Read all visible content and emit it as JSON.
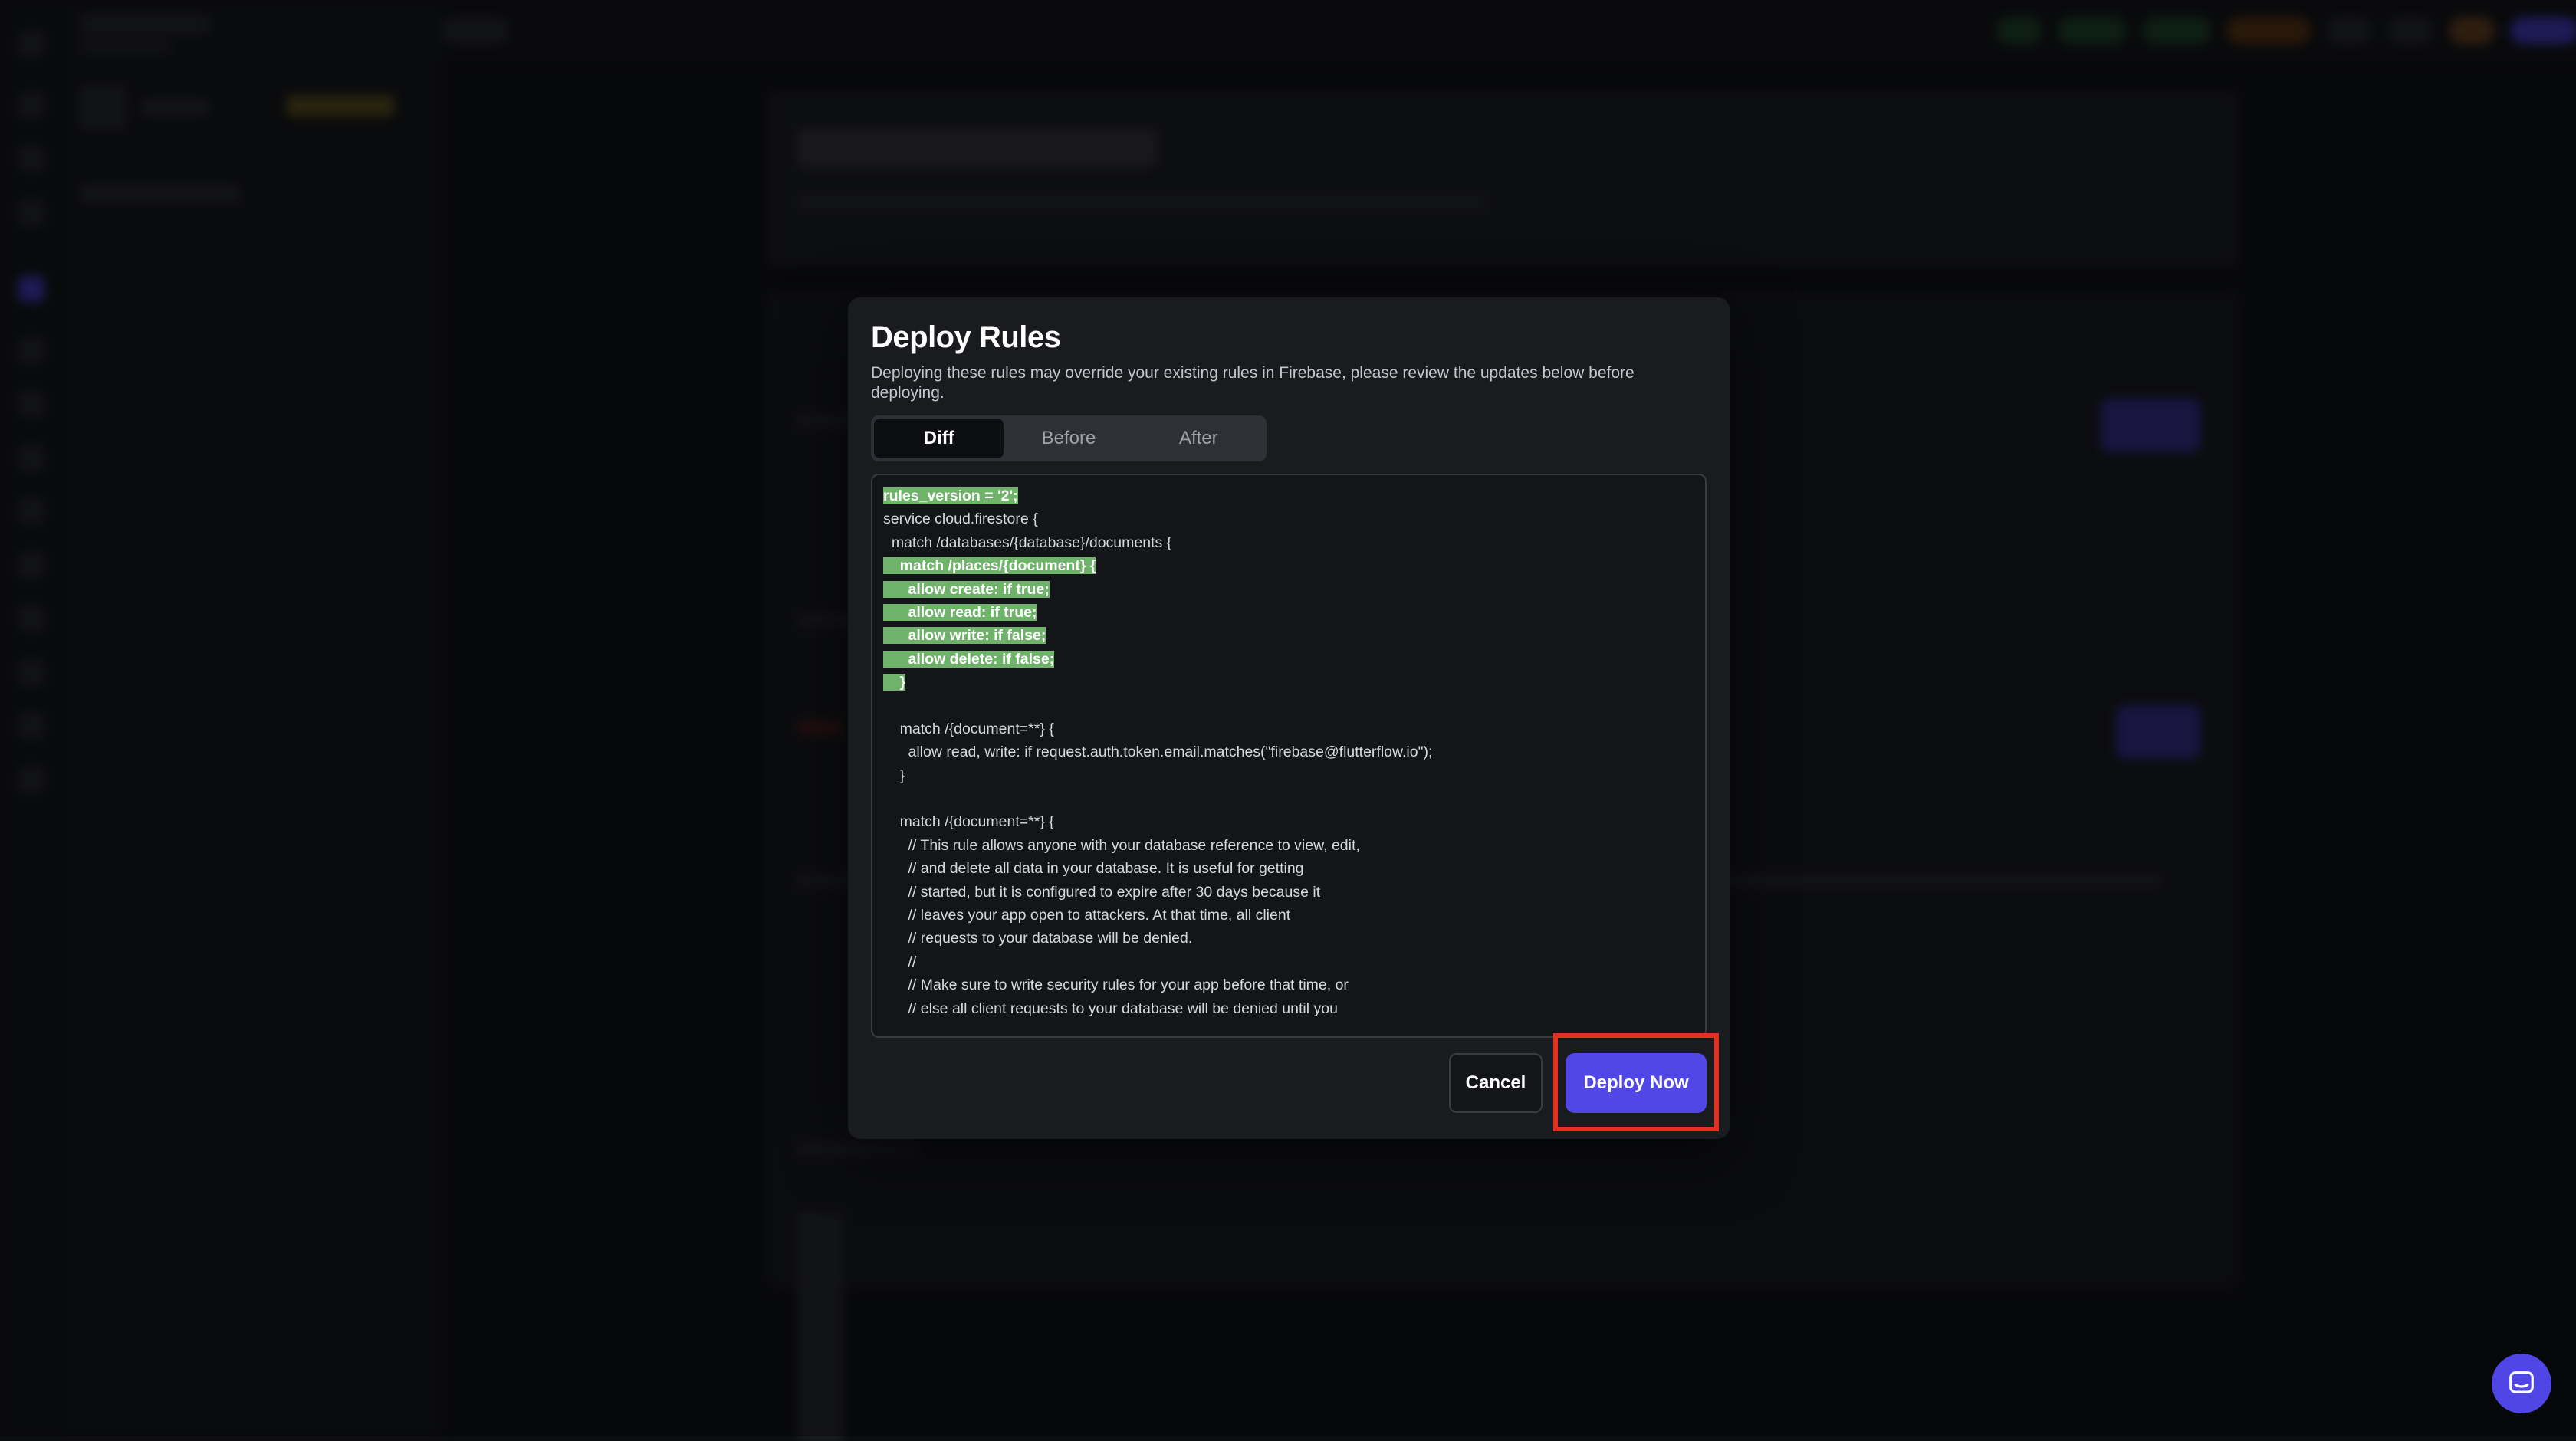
{
  "modal": {
    "title": "Deploy Rules",
    "description": "Deploying these rules may override your existing rules in Firebase, please review the updates below before deploying.",
    "tabs": [
      {
        "label": "Diff",
        "active": true
      },
      {
        "label": "Before",
        "active": false
      },
      {
        "label": "After",
        "active": false
      }
    ],
    "code_lines": [
      {
        "indent": 0,
        "text": "rules_version = '2';",
        "added": true
      },
      {
        "indent": 0,
        "text": "service cloud.firestore {",
        "added": false
      },
      {
        "indent": 1,
        "text": "match /databases/{database}/documents {",
        "added": false
      },
      {
        "indent": 2,
        "text": "match /places/{document} {",
        "added": true
      },
      {
        "indent": 3,
        "text": "allow create: if true;",
        "added": true
      },
      {
        "indent": 3,
        "text": "allow read: if true;",
        "added": true
      },
      {
        "indent": 3,
        "text": "allow write: if false;",
        "added": true
      },
      {
        "indent": 3,
        "text": "allow delete: if false;",
        "added": true
      },
      {
        "indent": 2,
        "text": "}",
        "added": true
      },
      {
        "indent": 0,
        "text": "",
        "added": false
      },
      {
        "indent": 2,
        "text": "match /{document=**} {",
        "added": false
      },
      {
        "indent": 3,
        "text": "allow read, write: if request.auth.token.email.matches(\"firebase@flutterflow.io\");",
        "added": false
      },
      {
        "indent": 2,
        "text": "}",
        "added": false
      },
      {
        "indent": 0,
        "text": "",
        "added": false
      },
      {
        "indent": 2,
        "text": "match /{document=**} {",
        "added": false
      },
      {
        "indent": 3,
        "text": "// This rule allows anyone with your database reference to view, edit,",
        "added": false
      },
      {
        "indent": 3,
        "text": "// and delete all data in your database. It is useful for getting",
        "added": false
      },
      {
        "indent": 3,
        "text": "// started, but it is configured to expire after 30 days because it",
        "added": false
      },
      {
        "indent": 3,
        "text": "// leaves your app open to attackers. At that time, all client",
        "added": false
      },
      {
        "indent": 3,
        "text": "// requests to your database will be denied.",
        "added": false
      },
      {
        "indent": 3,
        "text": "//",
        "added": false
      },
      {
        "indent": 3,
        "text": "// Make sure to write security rules for your app before that time, or",
        "added": false
      },
      {
        "indent": 3,
        "text": "// else all client requests to your database will be denied until you",
        "added": false
      }
    ],
    "cancel_label": "Cancel",
    "deploy_label": "Deploy Now"
  },
  "colors": {
    "accent": "#5146e6",
    "added_highlight": "#6fb26a",
    "annotation_box": "#e3301f",
    "modal_bg": "#1a1b1f"
  },
  "icons": {
    "chat": "chat-bubble-icon"
  }
}
